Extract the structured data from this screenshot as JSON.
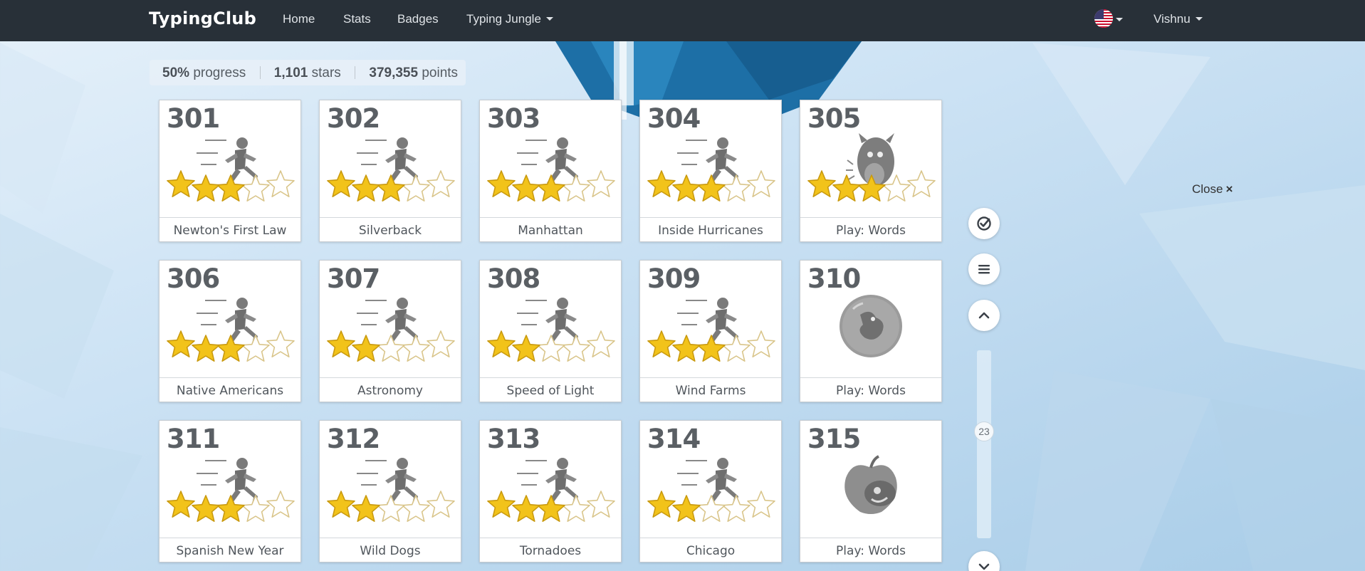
{
  "brand": "TypingClub",
  "nav": {
    "home": "Home",
    "stats": "Stats",
    "badges": "Badges",
    "jungle": "Typing Jungle",
    "user": "Vishnu"
  },
  "stats": {
    "progress_value": "50%",
    "progress_label": "progress",
    "stars_value": "1,101",
    "stars_label": "stars",
    "points_value": "379,355",
    "points_label": "points"
  },
  "close_label": "Close",
  "close_icon": "×",
  "scroll_marker": "23",
  "colors": {
    "navbar": "#283038",
    "star_gold": "#f2c31a",
    "card_text": "#5a5f64"
  },
  "lessons": [
    {
      "num": "301",
      "title": "Newton's First Law",
      "icon": "runner-icon",
      "stars": 3
    },
    {
      "num": "302",
      "title": "Silverback",
      "icon": "runner-icon",
      "stars": 3
    },
    {
      "num": "303",
      "title": "Manhattan",
      "icon": "runner-icon",
      "stars": 3
    },
    {
      "num": "304",
      "title": "Inside Hurricanes",
      "icon": "runner-icon",
      "stars": 3
    },
    {
      "num": "305",
      "title": "Play: Words",
      "icon": "monster-icon",
      "stars": 3
    },
    {
      "num": "306",
      "title": "Native Americans",
      "icon": "runner-icon",
      "stars": 3
    },
    {
      "num": "307",
      "title": "Astronomy",
      "icon": "runner-icon",
      "stars": 2
    },
    {
      "num": "308",
      "title": "Speed of Light",
      "icon": "runner-icon",
      "stars": 2
    },
    {
      "num": "309",
      "title": "Wind Farms",
      "icon": "runner-icon",
      "stars": 3
    },
    {
      "num": "310",
      "title": "Play: Words",
      "icon": "bubble-creature-icon",
      "stars": 0
    },
    {
      "num": "311",
      "title": "Spanish New Year",
      "icon": "runner-icon",
      "stars": 3
    },
    {
      "num": "312",
      "title": "Wild Dogs",
      "icon": "runner-icon",
      "stars": 2
    },
    {
      "num": "313",
      "title": "Tornadoes",
      "icon": "runner-icon",
      "stars": 3
    },
    {
      "num": "314",
      "title": "Chicago",
      "icon": "runner-icon",
      "stars": 2
    },
    {
      "num": "315",
      "title": "Play: Words",
      "icon": "apple-worm-icon",
      "stars": 0
    }
  ]
}
